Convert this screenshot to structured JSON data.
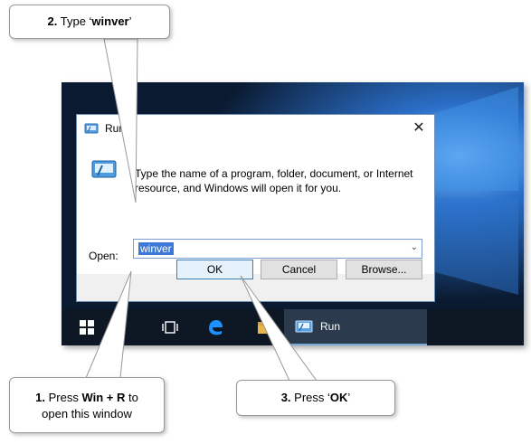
{
  "run_dialog": {
    "title": "Run",
    "description": "Type the name of a program, folder, document, or Internet resource, and Windows will open it for you.",
    "open_label": "Open:",
    "open_value": "winver",
    "ok_label": "OK",
    "cancel_label": "Cancel",
    "browse_label": "Browse..."
  },
  "taskbar": {
    "run_label": "Run",
    "icons": [
      "windows-start-icon",
      "task-view-icon",
      "edge-icon",
      "file-explorer-icon",
      "run-icon"
    ]
  },
  "callouts": {
    "step1": {
      "number": "1.",
      "text_a": "Press ",
      "keys": "Win + R",
      "text_b": " to",
      "line2": "open this window"
    },
    "step2": {
      "number": "2.",
      "text_a": "Type ‘",
      "keys": "winver",
      "text_b": "’"
    },
    "step3": {
      "number": "3.",
      "text_a": "Press ‘",
      "keys": "OK",
      "text_b": "’"
    }
  },
  "colors": {
    "accent": "#3b78d8",
    "taskbar": "#0e1724",
    "wallpaper_dark": "#0a1a30",
    "wallpaper_light": "#2f7fd6"
  }
}
